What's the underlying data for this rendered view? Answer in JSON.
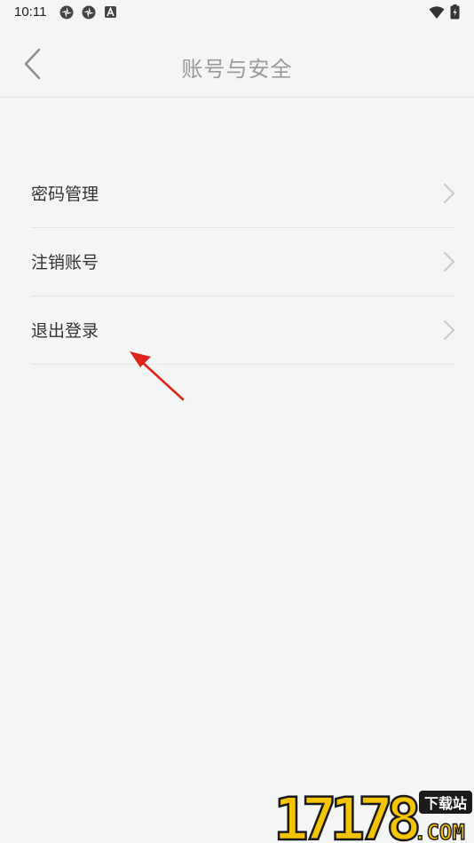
{
  "status_bar": {
    "time": "10:11"
  },
  "nav": {
    "title": "账号与安全"
  },
  "menu": {
    "items": [
      {
        "label": "密码管理"
      },
      {
        "label": "注销账号"
      },
      {
        "label": "退出登录"
      }
    ]
  },
  "watermark": {
    "number_text": "17178",
    "domain_text": ".COM",
    "badge_text": "下载站"
  },
  "colors": {
    "background": "#f4f5f5",
    "annotation_arrow": "#e0261b",
    "watermark_yellow": "#f5c400"
  }
}
